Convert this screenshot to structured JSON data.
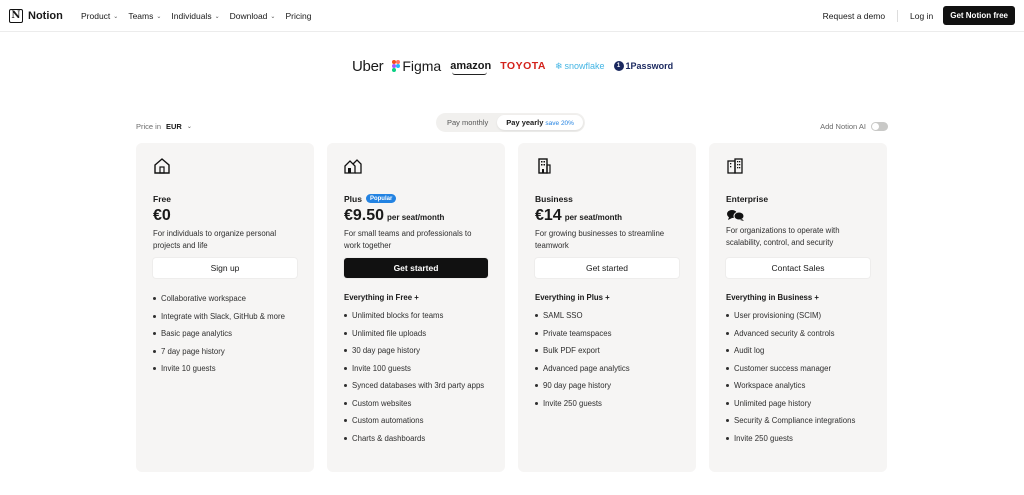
{
  "nav": {
    "brand": "Notion",
    "brand_mark": "N",
    "menu": [
      "Product",
      "Teams",
      "Individuals",
      "Download",
      "Pricing"
    ],
    "request_demo": "Request a demo",
    "login": "Log in",
    "cta": "Get Notion free"
  },
  "logos": {
    "uber": "Uber",
    "figma": "Figma",
    "amazon": "amazon",
    "toyota": "TOYOTA",
    "snowflake": "snowflake",
    "onepassword": "1Password",
    "onepassword_mark": "1"
  },
  "controls": {
    "price_in_label": "Price in",
    "currency": "EUR",
    "toggle_monthly": "Pay monthly",
    "toggle_yearly": "Pay yearly",
    "save_note": "save 20%",
    "add_ai": "Add Notion AI"
  },
  "plans": [
    {
      "name": "Free",
      "badge": "",
      "price": "€0",
      "per": "",
      "desc": "For individuals to organize personal projects and life",
      "button": "Sign up",
      "features_head": "",
      "features": [
        "Collaborative workspace",
        "Integrate with Slack, GitHub & more",
        "Basic page analytics",
        "7 day page history",
        "Invite 10 guests"
      ]
    },
    {
      "name": "Plus",
      "badge": "Popular",
      "price": "€9.50",
      "per": "per seat/month",
      "desc": "For small teams and professionals to work together",
      "button": "Get started",
      "features_head": "Everything in Free +",
      "features": [
        "Unlimited blocks for teams",
        "Unlimited file uploads",
        "30 day page history",
        "Invite 100 guests",
        "Synced databases with 3rd party apps",
        "Custom websites",
        "Custom automations",
        "Charts & dashboards"
      ]
    },
    {
      "name": "Business",
      "badge": "",
      "price": "€14",
      "per": "per seat/month",
      "desc": "For growing businesses to streamline teamwork",
      "button": "Get started",
      "features_head": "Everything in Plus +",
      "features": [
        "SAML SSO",
        "Private teamspaces",
        "Bulk PDF export",
        "Advanced page analytics",
        "90 day page history",
        "Invite 250 guests"
      ]
    },
    {
      "name": "Enterprise",
      "badge": "",
      "price": "",
      "per": "",
      "desc": "For organizations to operate with scalability, control, and security",
      "button": "Contact Sales",
      "features_head": "Everything in Business +",
      "features": [
        "User provisioning (SCIM)",
        "Advanced security & controls",
        "Audit log",
        "Customer success manager",
        "Workspace analytics",
        "Unlimited page history",
        "Security & Compliance integrations",
        "Invite 250 guests"
      ]
    }
  ],
  "colors": {
    "card_bg": "#f6f5f4",
    "accent_blue": "#2383e2",
    "toyota_red": "#d3221b",
    "snowflake_blue": "#44b5e4",
    "button_dark": "#111111"
  }
}
